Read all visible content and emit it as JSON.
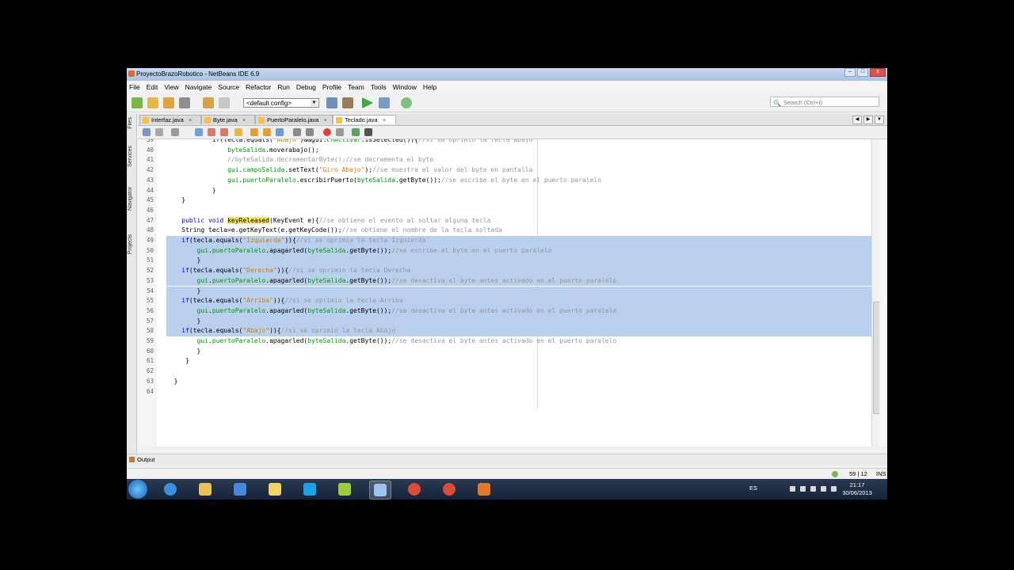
{
  "window": {
    "title": "ProyectoBrazoRobotico - NetBeans IDE 6.9",
    "controls": [
      "–",
      "□",
      "x"
    ]
  },
  "menu": [
    "File",
    "Edit",
    "View",
    "Navigate",
    "Source",
    "Refactor",
    "Run",
    "Debug",
    "Profile",
    "Team",
    "Tools",
    "Window",
    "Help"
  ],
  "toolbar": {
    "config_value": "<default config>",
    "search_placeholder": "Search (Ctrl+I)"
  },
  "side_panels": [
    "Files",
    "Services",
    "Navigator",
    "Projects"
  ],
  "tabs": [
    {
      "label": "Interfaz.java",
      "active": false
    },
    {
      "label": "Byte.java",
      "active": false
    },
    {
      "label": "PuertoParalelo.java",
      "active": false
    },
    {
      "label": "Teclado.java",
      "active": true
    }
  ],
  "code_lines": [
    {
      "n": "39",
      "parts": [
        [
          "",
          "            if(tecla.equals("
        ],
        [
          "st",
          "\"Abajo\""
        ],
        [
          "",
          ")&&gui."
        ],
        [
          "fld",
          "chActivar"
        ],
        [
          "",
          ".isSelected()){"
        ],
        [
          "cm",
          "//si se oprimio la tecla abajo"
        ]
      ]
    },
    {
      "n": "40",
      "parts": [
        [
          "",
          "                "
        ],
        [
          "fld",
          "byteSalida"
        ],
        [
          "",
          ".moverabajo();"
        ]
      ]
    },
    {
      "n": "41",
      "parts": [
        [
          "cm",
          "                //byteSalida.decrementarByte();//se decrementa el byte"
        ]
      ]
    },
    {
      "n": "42",
      "parts": [
        [
          "",
          "                "
        ],
        [
          "fld",
          "gui"
        ],
        [
          "",
          "."
        ],
        [
          "fld",
          "campoSalida"
        ],
        [
          "",
          ".setText("
        ],
        [
          "st",
          "\"Giro Abajo\""
        ],
        [
          "",
          ");"
        ],
        [
          "cm",
          "//se muestra el valor del byte en pantalla"
        ]
      ]
    },
    {
      "n": "43",
      "parts": [
        [
          "",
          "                "
        ],
        [
          "fld",
          "gui"
        ],
        [
          "",
          "."
        ],
        [
          "fld",
          "puertoParalelo"
        ],
        [
          "",
          ".escribirPuerto("
        ],
        [
          "fld",
          "byteSalida"
        ],
        [
          "",
          ".getByte());"
        ],
        [
          "cm",
          "//se escribe el byte en el puerto paralelo"
        ]
      ]
    },
    {
      "n": "44",
      "parts": [
        [
          "",
          "            }"
        ]
      ]
    },
    {
      "n": "45",
      "parts": [
        [
          "",
          "    }"
        ]
      ]
    },
    {
      "n": "46",
      "parts": [
        [
          "",
          ""
        ]
      ]
    },
    {
      "n": "47",
      "parts": [
        [
          "",
          "    "
        ],
        [
          "kw",
          "public void "
        ],
        [
          "mhl",
          "keyReleased"
        ],
        [
          "",
          "(KeyEvent e){"
        ],
        [
          "cm",
          "//se obtiene el evento al soltar alguna tecla"
        ]
      ]
    },
    {
      "n": "48",
      "parts": [
        [
          "",
          "    String tecla=e.getKeyText(e.getKeyCode());"
        ],
        [
          "cm",
          "//se obtiene el nombre de la tecla soltada"
        ]
      ]
    },
    {
      "n": "49",
      "sel": true,
      "parts": [
        [
          "",
          "    "
        ],
        [
          "kw",
          "if"
        ],
        [
          "",
          "(tecla.equals("
        ],
        [
          "st",
          "\"Izquierda\""
        ],
        [
          "",
          ")){"
        ],
        [
          "cm",
          "//si se oprimio la tecla Izquierda"
        ]
      ]
    },
    {
      "n": "50",
      "sel": true,
      "parts": [
        [
          "",
          "        "
        ],
        [
          "fld",
          "gui"
        ],
        [
          "",
          "."
        ],
        [
          "fld",
          "puertoParalelo"
        ],
        [
          "",
          ".apagarled("
        ],
        [
          "fld",
          "byteSalida"
        ],
        [
          "",
          ".getByte());"
        ],
        [
          "cm",
          "//se escribe el byte en el puerto paralelo"
        ]
      ]
    },
    {
      "n": "51",
      "sel": true,
      "parts": [
        [
          "",
          "        }"
        ]
      ]
    },
    {
      "n": "52",
      "sel": true,
      "parts": [
        [
          "",
          "    "
        ],
        [
          "kw",
          "if"
        ],
        [
          "",
          "(tecla.equals("
        ],
        [
          "st",
          "\"Derecha\""
        ],
        [
          "",
          ")){"
        ],
        [
          "cm",
          "//si se oprimio la tecla Derecha"
        ]
      ]
    },
    {
      "n": "53",
      "sel": true,
      "parts": [
        [
          "",
          "        "
        ],
        [
          "fld",
          "gui"
        ],
        [
          "",
          "."
        ],
        [
          "fld",
          "puertoParalelo"
        ],
        [
          "",
          ".apagarled("
        ],
        [
          "fld",
          "byteSalida"
        ],
        [
          "",
          ".getByte());"
        ],
        [
          "cm",
          "//se desactiva el byte antes activado en el puerto paralelo"
        ]
      ]
    },
    {
      "n": "54",
      "sel": true,
      "parts": [
        [
          "",
          "        }"
        ]
      ]
    },
    {
      "n": "55",
      "sel": true,
      "parts": [
        [
          "",
          "    "
        ],
        [
          "kw",
          "if"
        ],
        [
          "",
          "(tecla.equals("
        ],
        [
          "st",
          "\"Arriba\""
        ],
        [
          "",
          ")){"
        ],
        [
          "cm",
          "//si se oprimio la tecla Arriba"
        ]
      ]
    },
    {
      "n": "56",
      "sel": true,
      "parts": [
        [
          "",
          "        "
        ],
        [
          "fld",
          "gui"
        ],
        [
          "",
          "."
        ],
        [
          "fld",
          "puertoParalelo"
        ],
        [
          "",
          ".apagarled("
        ],
        [
          "fld",
          "byteSalida"
        ],
        [
          "",
          ".getByte());"
        ],
        [
          "cm",
          "//se desactiva el byte antes activado en el puerto paralelo"
        ]
      ]
    },
    {
      "n": "57",
      "sel": true,
      "parts": [
        [
          "",
          "        }"
        ]
      ]
    },
    {
      "n": "58",
      "sel": true,
      "parts": [
        [
          "",
          "    "
        ],
        [
          "kw",
          "if"
        ],
        [
          "",
          "(tecla.equals("
        ],
        [
          "st",
          "\"Abajo\""
        ],
        [
          "",
          ")){"
        ],
        [
          "cm",
          "//si se oprimio la tecla Abajo"
        ]
      ]
    },
    {
      "n": "59",
      "parts": [
        [
          "",
          "        "
        ],
        [
          "fld",
          "gui"
        ],
        [
          "",
          "."
        ],
        [
          "fld",
          "puertoParalelo"
        ],
        [
          "",
          ".apagarled("
        ],
        [
          "fld",
          "byteSalida"
        ],
        [
          "",
          ".getByte());"
        ],
        [
          "cm",
          "//se desactiva el byte antes activado en el puerto paralelo"
        ]
      ]
    },
    {
      "n": "60",
      "parts": [
        [
          "",
          "        }"
        ]
      ]
    },
    {
      "n": "61",
      "parts": [
        [
          "",
          "     }"
        ]
      ]
    },
    {
      "n": "62",
      "parts": [
        [
          "",
          ""
        ]
      ]
    },
    {
      "n": "63",
      "parts": [
        [
          "",
          "  }"
        ]
      ]
    },
    {
      "n": "64",
      "parts": [
        [
          "",
          ""
        ]
      ]
    }
  ],
  "output_label": "Output",
  "status": {
    "position": "59 | 12",
    "mode": "INS"
  },
  "tray": {
    "language": "ES",
    "time": "21:17",
    "date": "30/06/2013"
  },
  "taskbar_apps": [
    {
      "icon": "internet-explorer-icon",
      "color": "#3a8fe0"
    },
    {
      "icon": "folder-icon",
      "color": "#e9c35a"
    },
    {
      "icon": "media-player-icon",
      "color": "#4a86d9"
    },
    {
      "icon": "explorer-icon",
      "color": "#f2d36a"
    },
    {
      "icon": "skype-icon",
      "color": "#1aa3e8"
    },
    {
      "icon": "tool-icon",
      "color": "#9ccc3c"
    },
    {
      "icon": "netbeans-icon",
      "color": "#9fc3ef"
    },
    {
      "icon": "chrome-icon",
      "color": "#dd4b39"
    },
    {
      "icon": "chrome-icon",
      "color": "#dd4b39"
    },
    {
      "icon": "app-icon",
      "color": "#e07a2a"
    }
  ]
}
